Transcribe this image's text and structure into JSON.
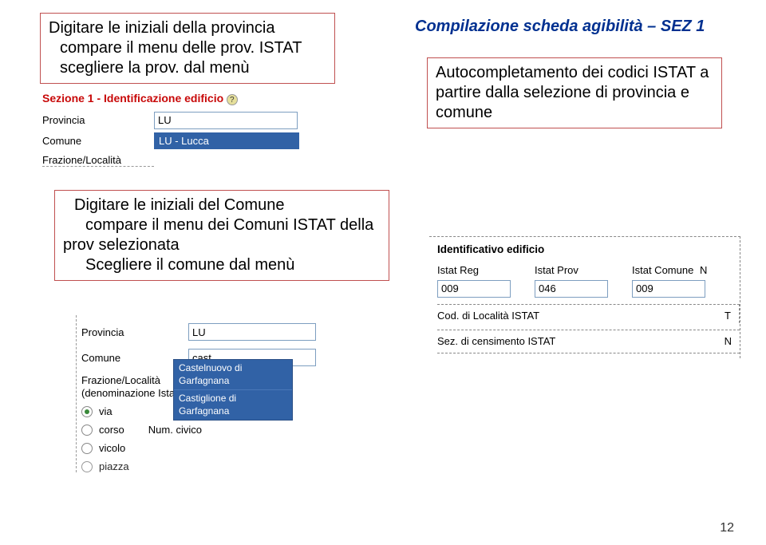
{
  "callouts": {
    "c1_line1": "Digitare le iniziali della provincia",
    "c1_line2": "compare il menu delle prov. ISTAT",
    "c1_line3": "scegliere  la prov. dal menù",
    "c2_line1": "Autocompletamento dei codici ISTAT a",
    "c2_line2": "partire dalla selezione di provincia e",
    "c2_line3": "comune",
    "c3_line1": "Digitare le iniziali del Comune",
    "c3_line2": "compare il menu dei Comuni ISTAT della",
    "c3_line3": "prov selezionata",
    "c3_line4": "Scegliere il comune dal menù"
  },
  "title": "Compilazione scheda agibilità – SEZ 1",
  "form1": {
    "section": "Sezione 1 - Identificazione edificio",
    "help": "?",
    "labels": {
      "provincia": "Provincia",
      "comune": "Comune",
      "frazione": "Frazione/Località"
    },
    "provincia_val": "LU",
    "dropdown_opt": "LU - Lucca"
  },
  "form2": {
    "labels": {
      "provincia": "Provincia",
      "comune": "Comune",
      "frazione_l1": "Frazione/Località",
      "frazione_l2": "(denominazione Istat)",
      "via": "via",
      "corso": "corso",
      "numcivico": "Num. civico",
      "vicolo": "vicolo",
      "piazza": "piazza"
    },
    "provincia_val": "LU",
    "comune_val": "cast",
    "suggestions": {
      "s1_l1": "Castelnuovo di",
      "s1_l2": "Garfagnana",
      "s2_l1": "Castiglione di",
      "s2_l2": "Garfagnana"
    }
  },
  "ident": {
    "title": "Identificativo edificio",
    "labels": {
      "reg": "Istat Reg",
      "prov": "Istat Prov",
      "com": "Istat Comune",
      "n": "N",
      "loc": "Cod. di Località ISTAT",
      "t": "T",
      "sez": "Sez. di censimento ISTAT"
    },
    "reg_val": "009",
    "prov_val": "046",
    "com_val": "009"
  },
  "page_number": "12"
}
